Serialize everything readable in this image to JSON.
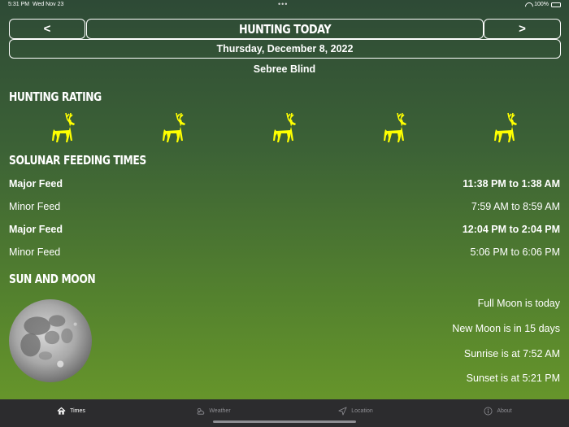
{
  "status": {
    "time": "5:31 PM",
    "date": "Wed Nov 23",
    "dots": "•••",
    "battery": "100%"
  },
  "header": {
    "prev_label": "<",
    "title": "HUNTING TODAY",
    "next_label": ">",
    "date": "Thursday, December 8, 2022",
    "location": "Sebree Blind"
  },
  "rating": {
    "heading": "HUNTING RATING",
    "value": 5,
    "max": 5,
    "icon": "deer-icon",
    "color": "#ffff00"
  },
  "solunar": {
    "heading": "SOLUNAR FEEDING TIMES",
    "rows": [
      {
        "label": "Major Feed",
        "time": "11:38 PM to 1:38 AM",
        "major": true
      },
      {
        "label": "Minor Feed",
        "time": "7:59 AM to 8:59 AM",
        "major": false
      },
      {
        "label": "Major Feed",
        "time": "12:04 PM to 2:04 PM",
        "major": true
      },
      {
        "label": "Minor Feed",
        "time": "5:06 PM to 6:06 PM",
        "major": false
      }
    ]
  },
  "sun_moon": {
    "heading": "SUN AND MOON",
    "moon_icon": "full-moon-image",
    "lines": [
      "Full Moon is today",
      "New Moon is in 15 days",
      "Sunrise is at 7:52 AM",
      "Sunset is at 5:21 PM"
    ]
  },
  "tabs": [
    {
      "label": "Times",
      "icon": "home-icon",
      "active": true
    },
    {
      "label": "Weather",
      "icon": "weather-icon",
      "active": false
    },
    {
      "label": "Location",
      "icon": "location-arrow-icon",
      "active": false
    },
    {
      "label": "About",
      "icon": "info-icon",
      "active": false
    }
  ],
  "colors": {
    "accent": "#ffff00",
    "tabbar": "#2c2c2e",
    "tab_inactive": "#8e8e93"
  }
}
